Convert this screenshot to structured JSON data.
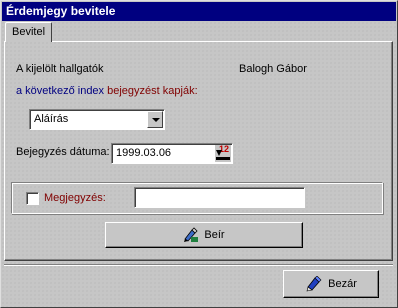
{
  "window": {
    "title": "Érdemjegy bevitele"
  },
  "tabs": [
    {
      "label": "Bevitel"
    }
  ],
  "form": {
    "students_label": "A kijelölt hallgatók",
    "student_name": "Balogh Gábor",
    "next_index_prefix": "a következő index ",
    "next_index_highlight": "bejegyzést kapják:",
    "entry_type": {
      "selected": "Aláírás"
    },
    "date_label": "Bejegyzés dátuma:",
    "date_value": "1999.03.06",
    "calendar_day": "12",
    "note_label": "Megjegyzés:",
    "note_value": "",
    "note_checked": false,
    "submit_label": "Beír"
  },
  "footer": {
    "close_label": "Bezár"
  },
  "colors": {
    "titlebar": "#000080",
    "text_blue": "#000080",
    "text_red": "#800000"
  }
}
